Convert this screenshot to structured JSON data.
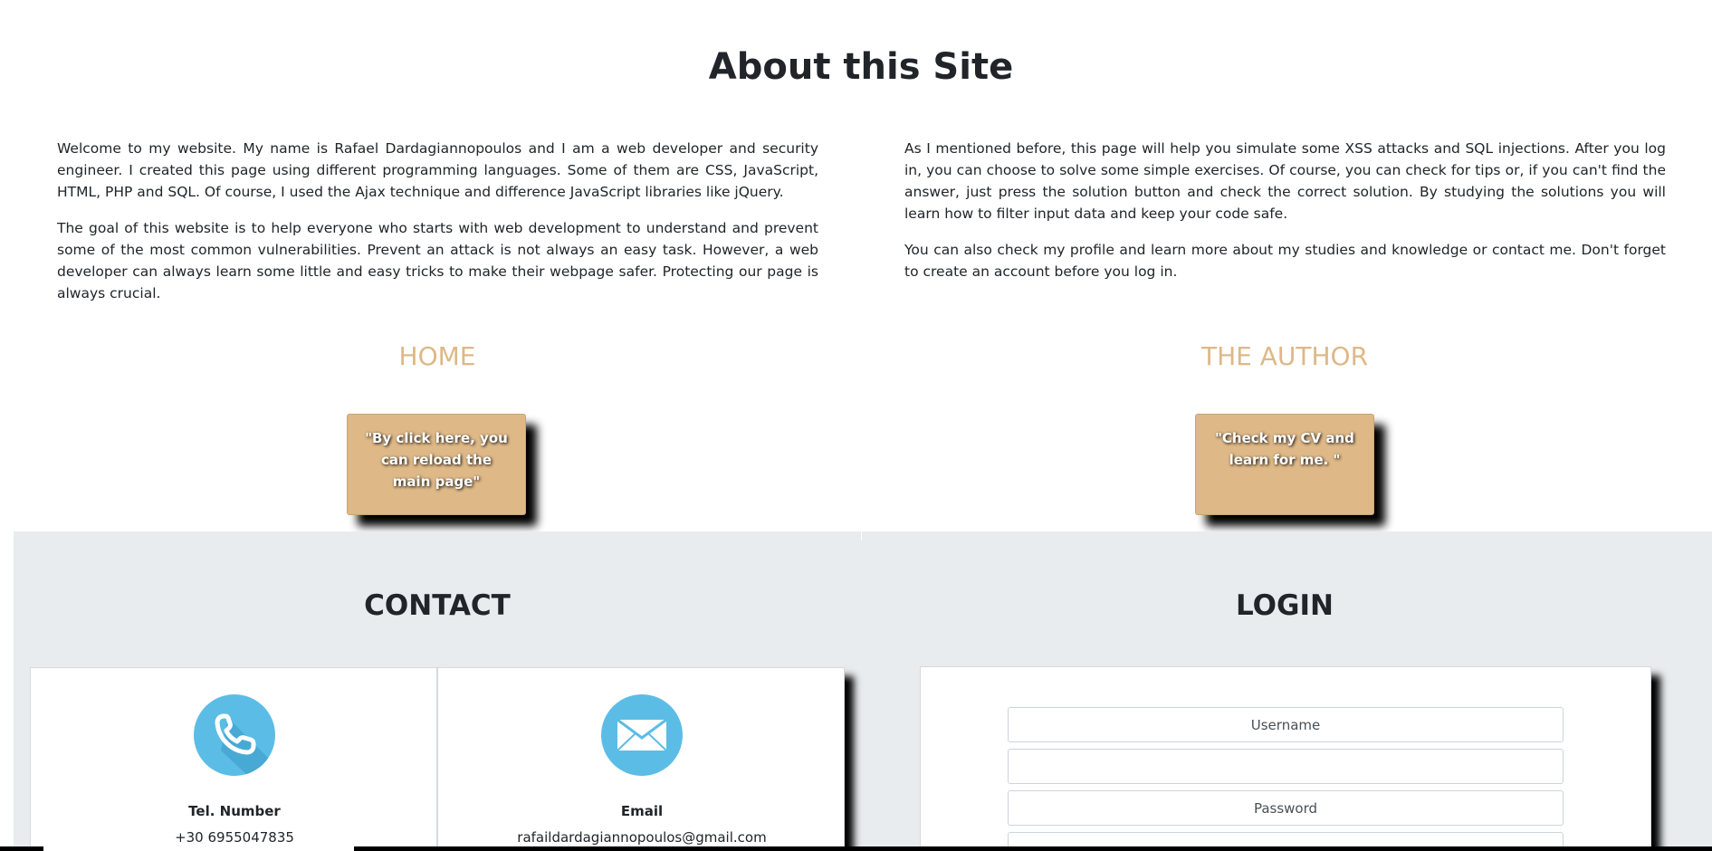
{
  "about": {
    "title": "About this Site",
    "left_paragraphs": [
      "Welcome to my website. My name is Rafael Dardagiannopoulos and I am a web developer and security engineer. I created this page using different programming languages. Some of them are CSS, JavaScript, HTML, PHP and SQL. Of course, I used the Ajax technique and difference JavaScript libraries like jQuery.",
      "The goal of this website is to help everyone who starts with web development to understand and prevent some of the most common vulnerabilities. Prevent an attack is not always an easy task. However, a web developer can always learn some little and easy tricks to make their webpage safer. Protecting our page is always crucial."
    ],
    "right_paragraphs": [
      "As I mentioned before, this page will help you simulate some XSS attacks and SQL injections. After you log in, you can choose to solve some simple exercises. Of course, you can check for tips or, if you can't find the answer, just press the solution button and check the correct solution. By studying the solutions you will learn how to filter input data and keep your code safe.",
      "You can also check my profile and learn more about my studies and knowledge or contact me. Don't forget to create an account before you log in."
    ]
  },
  "home": {
    "heading": "HOME",
    "tile_text": "\"By click here, you can reload the main page\""
  },
  "author": {
    "heading": "THE AUTHOR",
    "tile_text": "\"Check my CV and learn for me. \""
  },
  "contact": {
    "heading": "CONTACT",
    "phone_label": "Tel. Number",
    "phone_value": "+30 6955047835",
    "email_label": "Email",
    "email_value": "rafaildardagiannopoulos@gmail.com",
    "phone_icon": "phone-icon",
    "email_icon": "envelope-icon"
  },
  "login": {
    "heading": "LOGIN",
    "username_placeholder": "Username",
    "blank_placeholder": "",
    "password_placeholder": "Password"
  },
  "colors": {
    "accent": "#deb887",
    "band": "#e9ecef",
    "icon_circle": "#5bbde6"
  }
}
